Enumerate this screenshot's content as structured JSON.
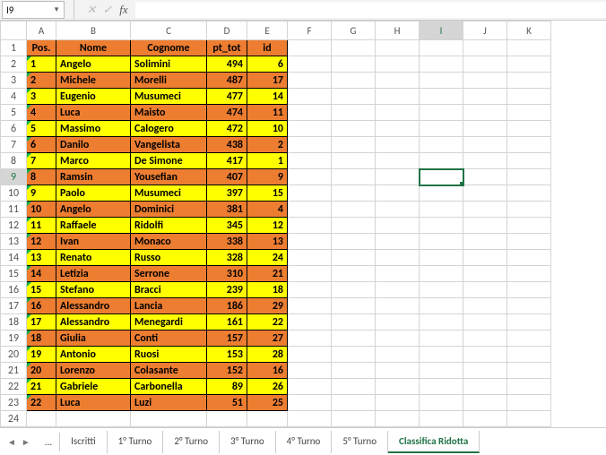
{
  "nameBox": "I9",
  "formula": "",
  "selectedCell": {
    "col": "I",
    "row": 9
  },
  "columns": [
    "A",
    "B",
    "C",
    "D",
    "E",
    "F",
    "G",
    "H",
    "I",
    "J",
    "K"
  ],
  "header": {
    "A": "Pos.",
    "B": "Nome",
    "C": "Cognome",
    "D": "pt_tot",
    "E": "id"
  },
  "rows": [
    {
      "pos": 1,
      "nome": "Angelo",
      "cognome": "Solimini",
      "pt": 494,
      "id": 6
    },
    {
      "pos": 2,
      "nome": "Michele",
      "cognome": "Morelli",
      "pt": 487,
      "id": 17
    },
    {
      "pos": 3,
      "nome": "Eugenio",
      "cognome": "Musumeci",
      "pt": 477,
      "id": 14
    },
    {
      "pos": 4,
      "nome": "Luca",
      "cognome": "Maisto",
      "pt": 474,
      "id": 11
    },
    {
      "pos": 5,
      "nome": "Massimo",
      "cognome": "Calogero",
      "pt": 472,
      "id": 10
    },
    {
      "pos": 6,
      "nome": "Danilo",
      "cognome": "Vangelista",
      "pt": 438,
      "id": 2
    },
    {
      "pos": 7,
      "nome": "Marco",
      "cognome": "De Simone",
      "pt": 417,
      "id": 1
    },
    {
      "pos": 8,
      "nome": "Ramsin",
      "cognome": "Yousefian",
      "pt": 407,
      "id": 9
    },
    {
      "pos": 9,
      "nome": "Paolo",
      "cognome": "Musumeci",
      "pt": 397,
      "id": 15
    },
    {
      "pos": 10,
      "nome": "Angelo",
      "cognome": "Dominici",
      "pt": 381,
      "id": 4
    },
    {
      "pos": 11,
      "nome": "Raffaele",
      "cognome": "Ridolfi",
      "pt": 345,
      "id": 12
    },
    {
      "pos": 12,
      "nome": "Ivan",
      "cognome": "Monaco",
      "pt": 338,
      "id": 13
    },
    {
      "pos": 13,
      "nome": "Renato",
      "cognome": "Russo",
      "pt": 328,
      "id": 24
    },
    {
      "pos": 14,
      "nome": "Letizia",
      "cognome": "Serrone",
      "pt": 310,
      "id": 21
    },
    {
      "pos": 15,
      "nome": "Stefano",
      "cognome": "Bracci",
      "pt": 239,
      "id": 18
    },
    {
      "pos": 16,
      "nome": "Alessandro",
      "cognome": "Lancia",
      "pt": 186,
      "id": 29
    },
    {
      "pos": 17,
      "nome": "Alessandro",
      "cognome": "Menegardi",
      "pt": 161,
      "id": 22
    },
    {
      "pos": 18,
      "nome": "Giulia",
      "cognome": "Conti",
      "pt": 157,
      "id": 27
    },
    {
      "pos": 19,
      "nome": "Antonio",
      "cognome": "Ruosi",
      "pt": 153,
      "id": 28
    },
    {
      "pos": 20,
      "nome": "Lorenzo",
      "cognome": "Colasante",
      "pt": 152,
      "id": 16
    },
    {
      "pos": 21,
      "nome": "Gabriele",
      "cognome": "Carbonella",
      "pt": 89,
      "id": 26
    },
    {
      "pos": 22,
      "nome": "Luca",
      "cognome": "Luzi",
      "pt": 51,
      "id": 25
    }
  ],
  "extraRows": [
    24
  ],
  "tabs": {
    "ellipsis": "...",
    "items": [
      "Iscritti",
      "1° Turno",
      "2° Turno",
      "3° Turno",
      "4° Turno",
      "5° Turno",
      "Classifica Ridotta"
    ],
    "active": "Classifica Ridotta"
  }
}
